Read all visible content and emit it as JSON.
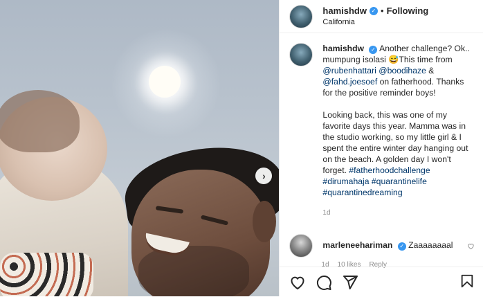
{
  "header": {
    "username": "hamishdw",
    "separator": "•",
    "follow_status": "Following",
    "location": "California"
  },
  "caption": {
    "username": "hamishdw",
    "line1": "Another challenge? Ok.. mumpung isolasi 😅This time from ",
    "mention1": "@rubenhattari",
    "mention2": "@boodihaze",
    "amp": " & ",
    "mention3": "@fahd.joesoef",
    "after_mentions": " on fatherhood. Thanks for the positive reminder boys!",
    "paragraph2": "Looking back, this was one of my favorite days this year. Mamma was in the studio working, so my little girl & I spent the entire winter day hanging out on the beach. A golden day I won't forget. ",
    "hashtags": [
      "#fatherhoodchallenge",
      "#dirumahaja",
      "#quarantinelife",
      "#quarantinedreaming"
    ],
    "time": "1d"
  },
  "comment": {
    "username": "marleneehariman",
    "text": "Zaaaaaaaal",
    "time": "1d",
    "likes": "10 likes",
    "reply": "Reply"
  },
  "icons": {
    "verified": "verified-badge-icon",
    "next": "chevron-right-icon",
    "like": "heart-icon",
    "comment": "comment-icon",
    "share": "share-icon",
    "save": "bookmark-icon"
  },
  "colors": {
    "verified": "#3897f0",
    "link": "#00376b",
    "meta": "#8e8e8e"
  }
}
